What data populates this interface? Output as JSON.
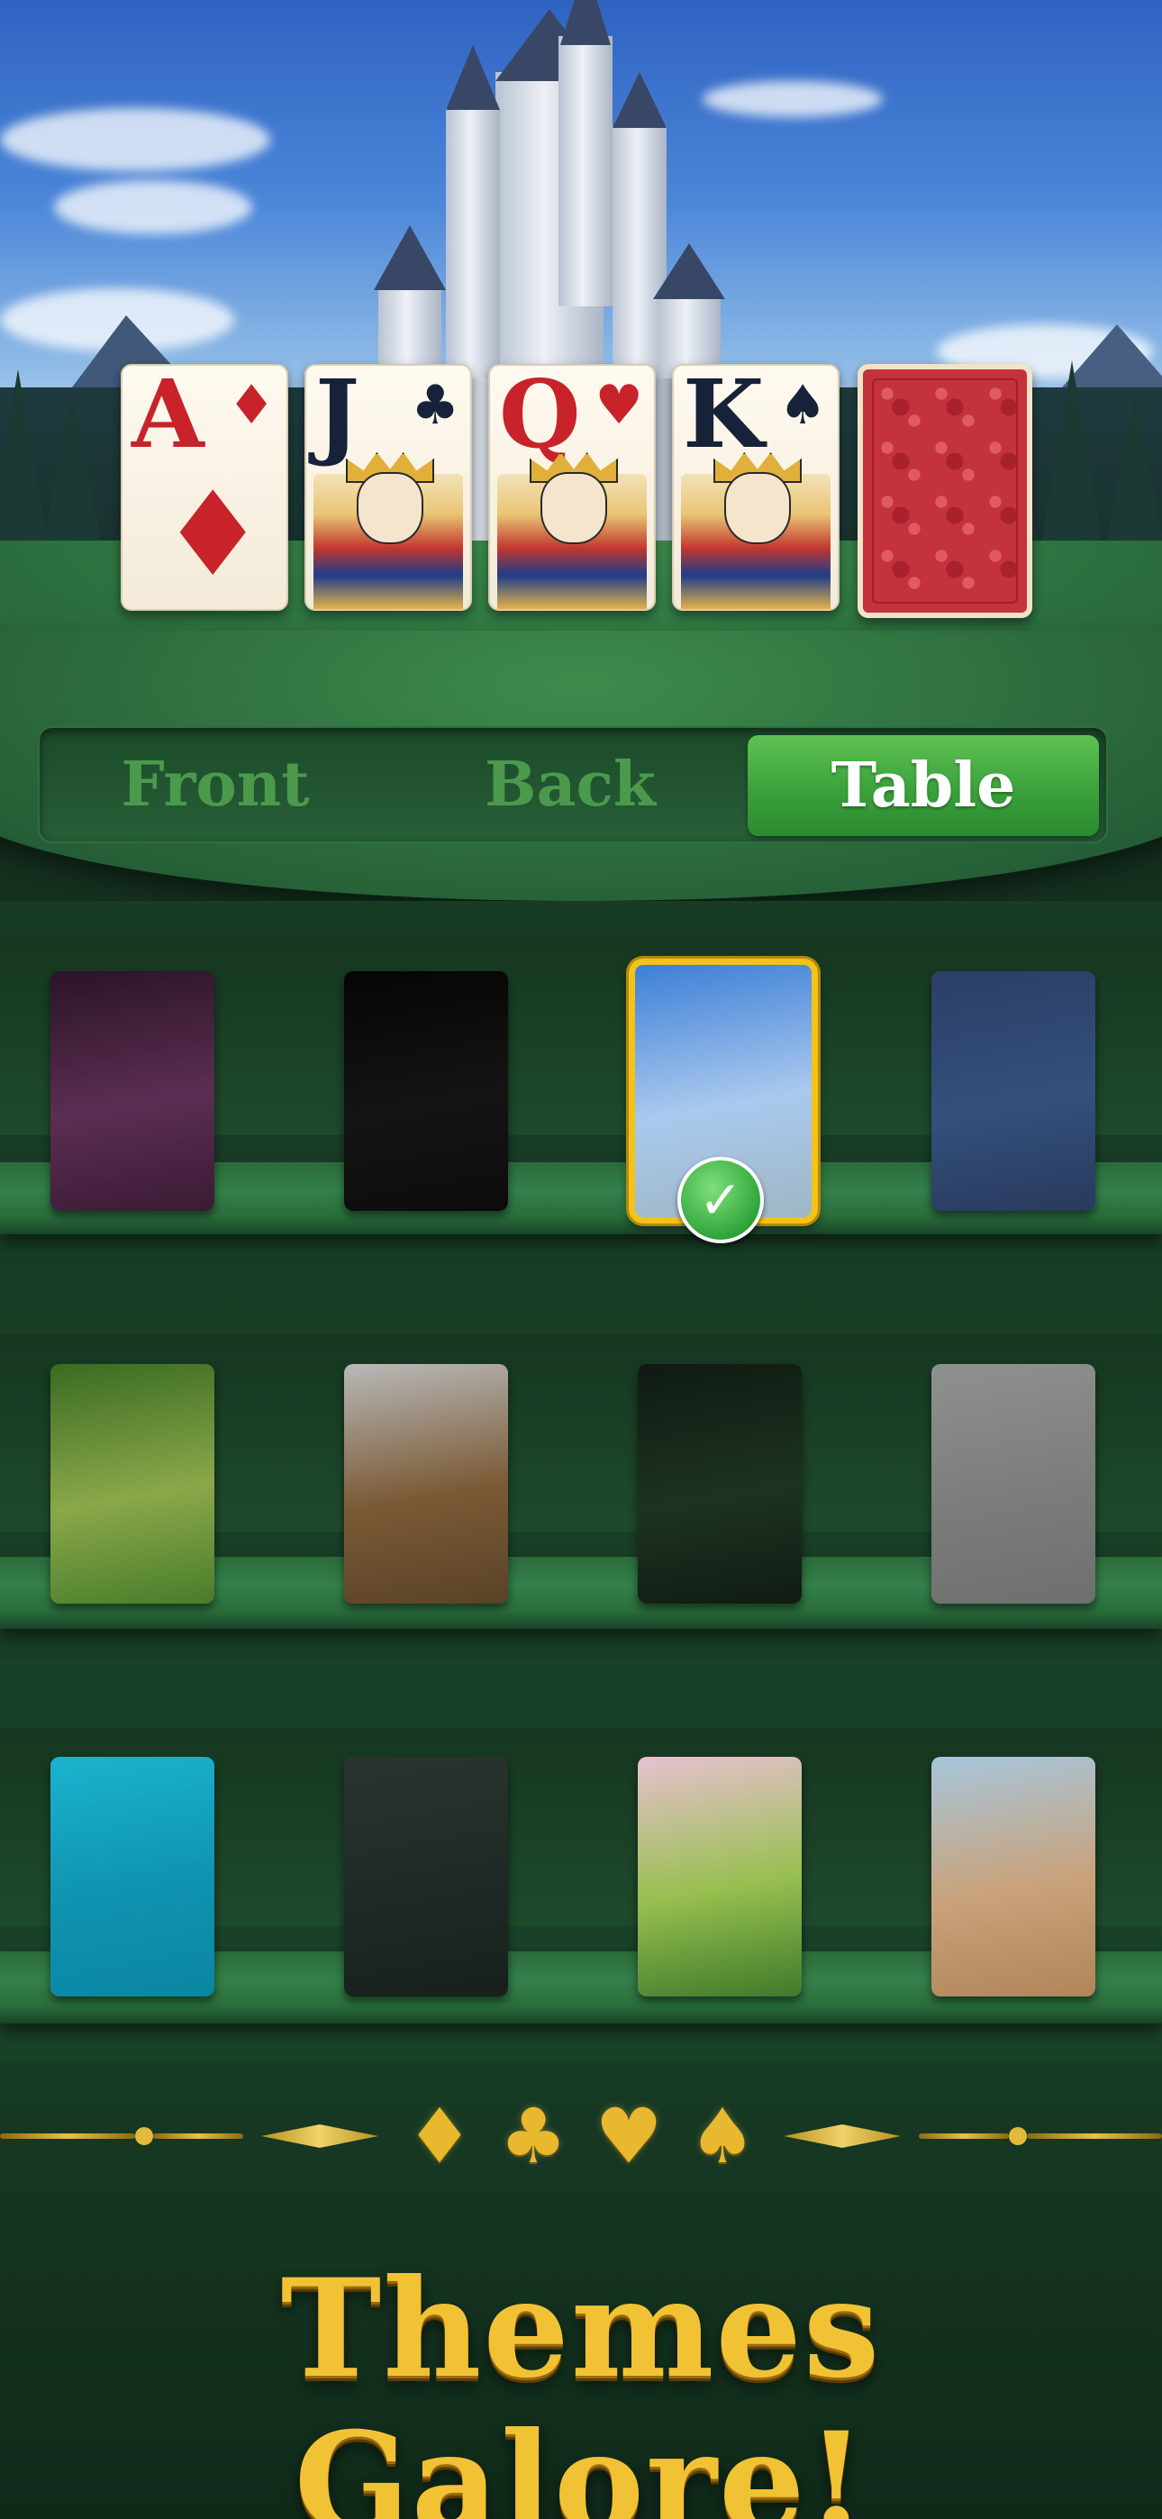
{
  "hero": {
    "cards": [
      {
        "rank": "A",
        "suit": "♦",
        "color": "red",
        "type": "ace"
      },
      {
        "rank": "J",
        "suit": "♣",
        "color": "black",
        "type": "face"
      },
      {
        "rank": "Q",
        "suit": "♥",
        "color": "red",
        "type": "face"
      },
      {
        "rank": "K",
        "suit": "♠",
        "color": "black",
        "type": "face"
      },
      {
        "rank": "",
        "suit": "",
        "color": "red",
        "type": "back"
      }
    ]
  },
  "tabs": [
    {
      "label": "Front",
      "active": false
    },
    {
      "label": "Back",
      "active": false
    },
    {
      "label": "Table",
      "active": true
    }
  ],
  "themes": [
    {
      "name": "purple-leaves",
      "colors": [
        "#2a1426",
        "#5b2e52",
        "#3a1b35"
      ]
    },
    {
      "name": "night-tent",
      "colors": [
        "#050505",
        "#141414",
        "#0c0c0c"
      ]
    },
    {
      "name": "castle",
      "colors": [
        "#3d7fd6",
        "#a9c9ee",
        "#9fb7c4"
      ],
      "selected": true
    },
    {
      "name": "daisies",
      "colors": [
        "#2b3f66",
        "#34507c",
        "#283a5d"
      ]
    },
    {
      "name": "kitten",
      "colors": [
        "#3b6b22",
        "#8aa84a",
        "#4a7c2a"
      ]
    },
    {
      "name": "desert-road",
      "colors": [
        "#b9b9b9",
        "#7a5a35",
        "#5a4228"
      ]
    },
    {
      "name": "dark-foliage",
      "colors": [
        "#0f1a12",
        "#1d3322",
        "#101b13"
      ]
    },
    {
      "name": "grey-leaves",
      "colors": [
        "#8e918d",
        "#7a7d79",
        "#6d706c"
      ]
    },
    {
      "name": "canoe-water",
      "colors": [
        "#1bb3cf",
        "#0f93b0",
        "#0b86a3"
      ]
    },
    {
      "name": "hot-air-balloon",
      "colors": [
        "#2a3330",
        "#1f2a26",
        "#161f1b"
      ]
    },
    {
      "name": "green-hills",
      "colors": [
        "#e7c1cf",
        "#97bf4f",
        "#3f7a2b"
      ]
    },
    {
      "name": "giraffe",
      "colors": [
        "#a7c6dc",
        "#c9a27a",
        "#b08659"
      ]
    }
  ],
  "footer": {
    "suits": [
      "♦",
      "♣",
      "♥",
      "♠"
    ],
    "headline": "Themes Galore!"
  },
  "accent": {
    "gold": "#f2c235",
    "green": "#3aa23a",
    "selected_border": "#f3c21b"
  }
}
